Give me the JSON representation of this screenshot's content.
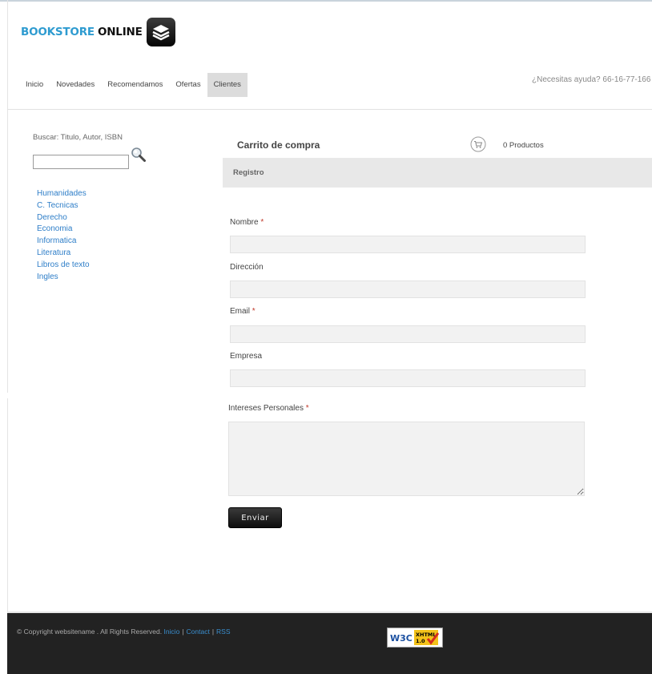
{
  "header": {
    "brand_part1": "BOOKSTORE",
    "brand_part2": "ONLINE",
    "help_text": "¿Necesitas ayuda? 66-16-77-166",
    "nav": [
      "Inicio",
      "Novedades",
      "Recomendamos",
      "Ofertas",
      "Clientes"
    ],
    "active_nav": "Clientes"
  },
  "sidebar": {
    "search_label": "Buscar: Titulo, Autor, ISBN",
    "search_value": "",
    "categories": [
      "Humanidades",
      "C. Tecnicas",
      "Derecho",
      "Economia",
      "Informatica",
      "Literatura",
      "Libros de texto",
      "Ingles"
    ]
  },
  "cart": {
    "title": "Carrito de compra",
    "count": "0 Productos"
  },
  "form": {
    "section_title": "Registro",
    "nombre_label": "Nombre",
    "direccion_label": "Dirección",
    "email_label": "Email",
    "empresa_label": "Empresa",
    "intereses_label": "Intereses Personales",
    "required_mark": "*",
    "submit_label": "Enviar"
  },
  "footer": {
    "copyright": "© Copyright websitename . All Rights Reserved.",
    "links": [
      "Inicio",
      "Contact",
      "RSS"
    ],
    "badge_w3c": "W3C",
    "badge_xhtml": "XHTML",
    "badge_version": "1.0"
  },
  "colors": {
    "brand_blue": "#2e9bd0",
    "link_blue": "#2e7ec8",
    "required_red": "#c0392b",
    "footer_bg": "#222222",
    "active_tab_bg": "#dcdcdc"
  },
  "icons": [
    "logo-book-icon",
    "magnifier-icon",
    "cart-icon",
    "resize-grip-icon",
    "w3c-check-icon"
  ]
}
